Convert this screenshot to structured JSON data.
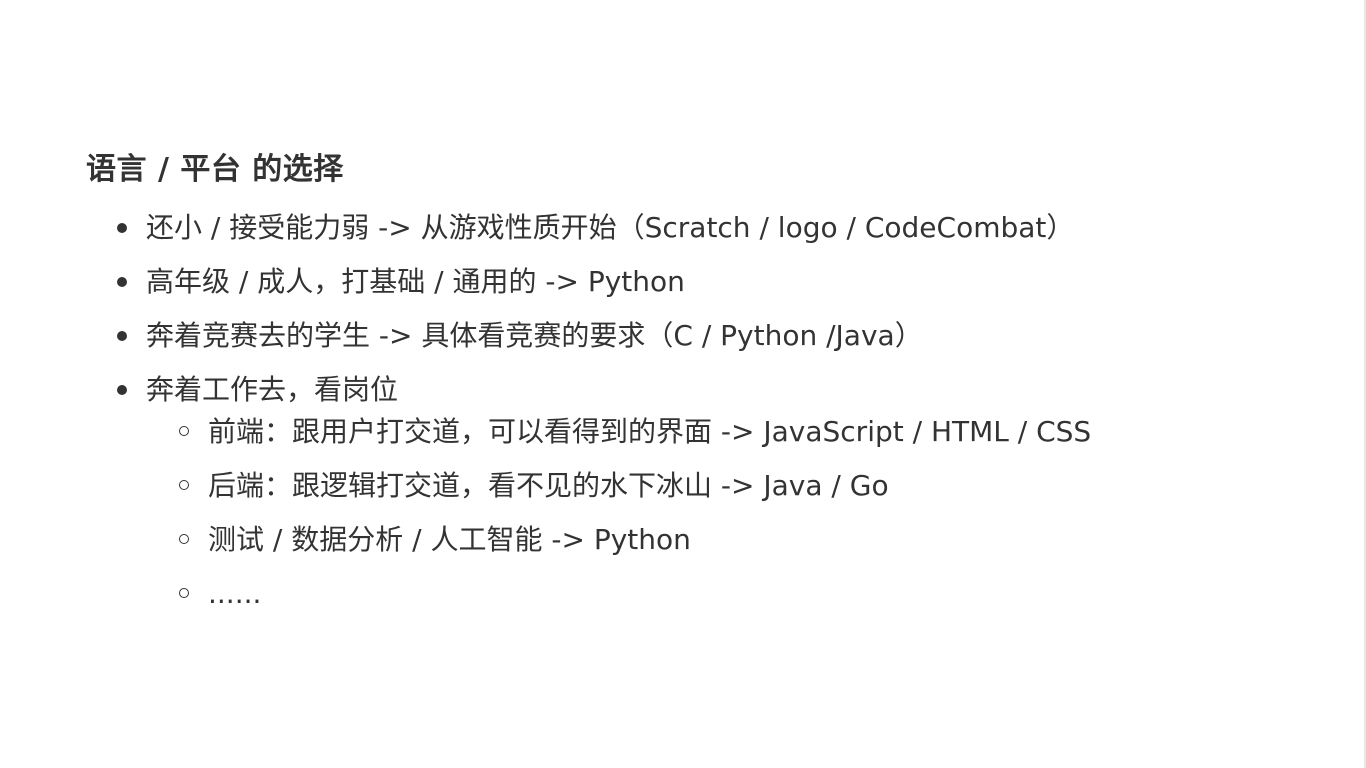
{
  "heading": "语言 / 平台 的选择",
  "items": [
    {
      "text": "还小 / 接受能力弱 -> 从游戏性质开始（Scratch / logo / CodeCombat）"
    },
    {
      "text": "高年级 / 成人，打基础 / 通用的 -> Python"
    },
    {
      "text": "奔着竞赛去的学生 -> 具体看竞赛的要求（C / Python /Java）"
    },
    {
      "text": "奔着工作去，看岗位",
      "subitems": [
        {
          "text": "前端：跟用户打交道，可以看得到的界面 -> JavaScript / HTML / CSS"
        },
        {
          "text": "后端：跟逻辑打交道，看不见的水下冰山 -> Java / Go"
        },
        {
          "text": "测试 / 数据分析 / 人工智能 -> Python"
        },
        {
          "text": "......"
        }
      ]
    }
  ]
}
